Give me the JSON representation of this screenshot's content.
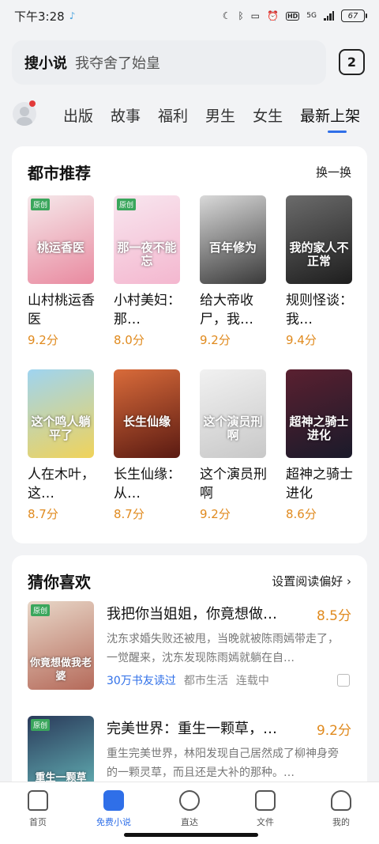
{
  "status_bar": {
    "time": "下午3:28",
    "network": "5G",
    "battery": "67"
  },
  "search": {
    "label": "搜小说",
    "query": "我夺舍了始皇"
  },
  "tab_count": "2",
  "categories": [
    "出版",
    "故事",
    "福利",
    "男生",
    "女生",
    "最新上架"
  ],
  "active_category": "最新上架",
  "city_section": {
    "title": "都市推荐",
    "action": "换一换",
    "books": [
      {
        "name": "山村桃运香医",
        "score": "9.2分",
        "cover_text": "桃运香医",
        "tag": "原创",
        "colors": [
          "#f5e8ea",
          "#e98aa0"
        ]
      },
      {
        "name": "小村美妇：那…",
        "score": "8.0分",
        "cover_text": "那一夜不能忘",
        "tag": "原创",
        "colors": [
          "#f8e6ef",
          "#f4b7cf"
        ]
      },
      {
        "name": "给大帝收尸，我…",
        "score": "9.2分",
        "cover_text": "百年修为",
        "tag": "",
        "colors": [
          "#d9d9d9",
          "#3a3a3a"
        ]
      },
      {
        "name": "规则怪谈：我…",
        "score": "9.4分",
        "cover_text": "我的家人不正常",
        "tag": "",
        "colors": [
          "#6b6b6b",
          "#1e1e1e"
        ]
      },
      {
        "name": "人在木叶，这…",
        "score": "8.7分",
        "cover_text": "这个鸣人躺平了",
        "tag": "",
        "colors": [
          "#9fd4f0",
          "#f0d35a"
        ]
      },
      {
        "name": "长生仙缘：从…",
        "score": "8.7分",
        "cover_text": "长生仙缘",
        "tag": "",
        "colors": [
          "#d96b3a",
          "#5a1a12"
        ]
      },
      {
        "name": "这个演员刑啊",
        "score": "9.2分",
        "cover_text": "这个演员刑啊",
        "tag": "",
        "colors": [
          "#f1f1f1",
          "#c8c8c8"
        ]
      },
      {
        "name": "超神之骑士进化",
        "score": "8.6分",
        "cover_text": "超神之骑士进化",
        "tag": "",
        "colors": [
          "#5a2030",
          "#1a1a2a"
        ]
      }
    ]
  },
  "guess_section": {
    "title": "猜你喜欢",
    "action": "设置阅读偏好 ›",
    "items": [
      {
        "title": "我把你当姐姐，你竟想做…",
        "score": "8.5分",
        "desc": "沈东求婚失败还被甩，当晚就被陈雨嫣带走了，一觉醒来，沈东发现陈雨嫣就躺在自…",
        "readers": "30万书友读过",
        "genre": "都市生活",
        "status": "连载中",
        "cover_text": "你竟想做我老婆",
        "tag": "原创",
        "colors": [
          "#e8d7c8",
          "#b56a5a"
        ]
      },
      {
        "title": "完美世界：重生一颗草，…",
        "score": "9.2分",
        "desc": "重生完美世界，林阳发现自己居然成了柳神身旁的一颗灵草，而且还是大补的那种。…",
        "readers": "",
        "genre": "",
        "status": "",
        "cover_text": "重生一颗草",
        "tag": "原创",
        "colors": [
          "#2a3a5a",
          "#6ac0c0"
        ]
      }
    ]
  },
  "bottom_nav": [
    {
      "label": "首页",
      "icon": "home-icon"
    },
    {
      "label": "免费小说",
      "icon": "book-icon"
    },
    {
      "label": "直达",
      "icon": "at-icon"
    },
    {
      "label": "文件",
      "icon": "download-icon"
    },
    {
      "label": "我的",
      "icon": "profile-icon"
    }
  ],
  "active_nav": "免费小说",
  "accent_color": "#2f6fe8",
  "score_color": "#e08a1e"
}
